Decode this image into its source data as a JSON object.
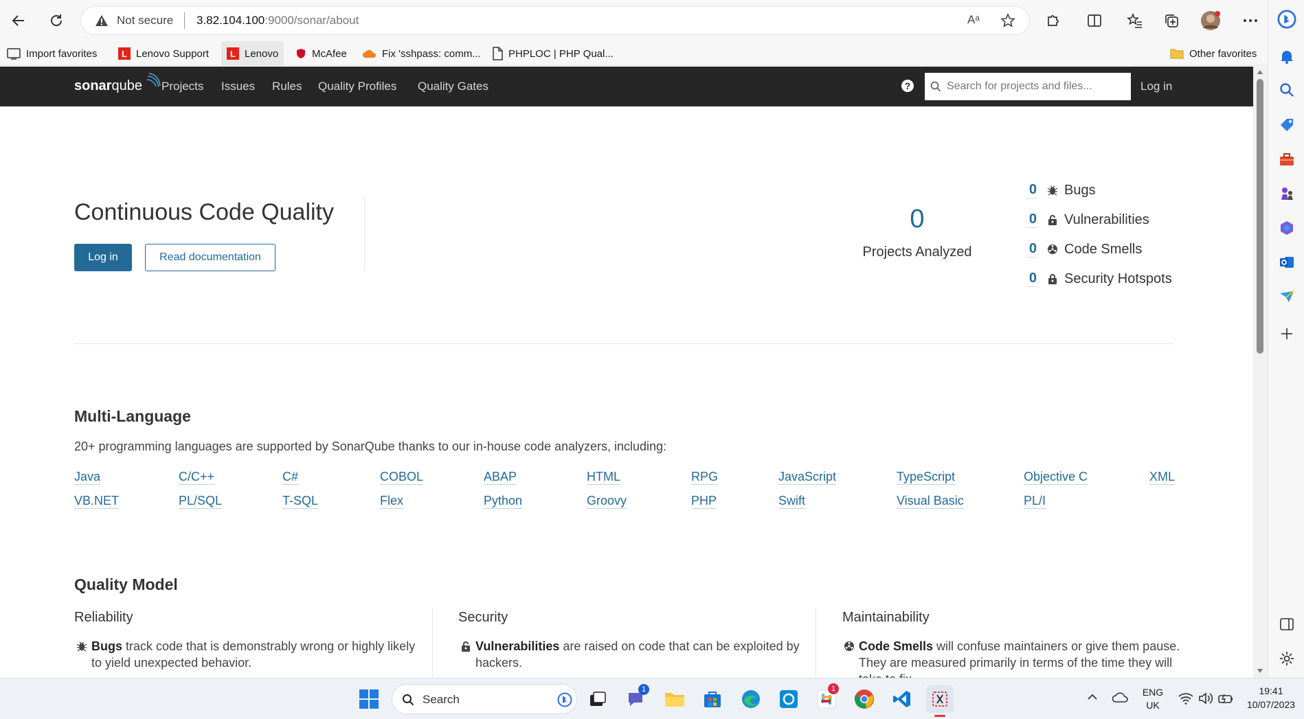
{
  "browser": {
    "security_label": "Not secure",
    "url_host": "3.82.104.100",
    "url_rest": ":9000/sonar/about",
    "favorites": [
      {
        "label": "Import favorites"
      },
      {
        "label": "Lenovo Support"
      },
      {
        "label": "Lenovo"
      },
      {
        "label": "McAfee"
      },
      {
        "label": "Fix 'sshpass: comm..."
      },
      {
        "label": "PHPLOC | PHP Qual..."
      }
    ],
    "other_favorites": "Other favorites",
    "read_aloud_glyph": "Aᵃ"
  },
  "navbar": {
    "logo_a": "sonar",
    "logo_b": "qube",
    "links": [
      "Projects",
      "Issues",
      "Rules",
      "Quality Profiles",
      "Quality Gates"
    ],
    "help_glyph": "?",
    "search_placeholder": "Search for projects and files...",
    "login": "Log in"
  },
  "hero": {
    "title": "Continuous Code Quality",
    "login_button": "Log in",
    "docs_button": "Read documentation",
    "projects_count": "0",
    "projects_label": "Projects Analyzed",
    "stats": [
      {
        "count": "0",
        "label": "Bugs",
        "icon": "bug-icon"
      },
      {
        "count": "0",
        "label": "Vulnerabilities",
        "icon": "lock-icon"
      },
      {
        "count": "0",
        "label": "Code Smells",
        "icon": "radiation-icon"
      },
      {
        "count": "0",
        "label": "Security Hotspots",
        "icon": "lock-icon"
      }
    ]
  },
  "languages": {
    "title": "Multi-Language",
    "description": "20+ programming languages are supported by SonarQube thanks to our in-house code analyzers, including:",
    "row1": [
      "Java",
      "C/C++",
      "C#",
      "COBOL",
      "ABAP",
      "HTML",
      "RPG",
      "JavaScript",
      "TypeScript",
      "Objective C",
      "XML"
    ],
    "row2": [
      "VB.NET",
      "PL/SQL",
      "T-SQL",
      "Flex",
      "Python",
      "Groovy",
      "PHP",
      "Swift",
      "Visual Basic",
      "PL/I"
    ]
  },
  "quality_model": {
    "title": "Quality Model",
    "columns": [
      {
        "title": "Reliability",
        "term": "Bugs",
        "text": " track code that is demonstrably wrong or highly likely to yield unexpected behavior."
      },
      {
        "title": "Security",
        "term": "Vulnerabilities",
        "text": " are raised on code that can be exploited by hackers."
      },
      {
        "title": "Maintainability",
        "term": "Code Smells",
        "text": " will confuse maintainers or give them pause. They are measured primarily in terms of the time they will take to fix."
      }
    ]
  },
  "taskbar": {
    "search_label": "Search",
    "teams_badge": "1",
    "slack_badge": "1",
    "lang_line1": "ENG",
    "lang_line2": "UK",
    "time": "19:41",
    "date": "10/07/2023"
  }
}
